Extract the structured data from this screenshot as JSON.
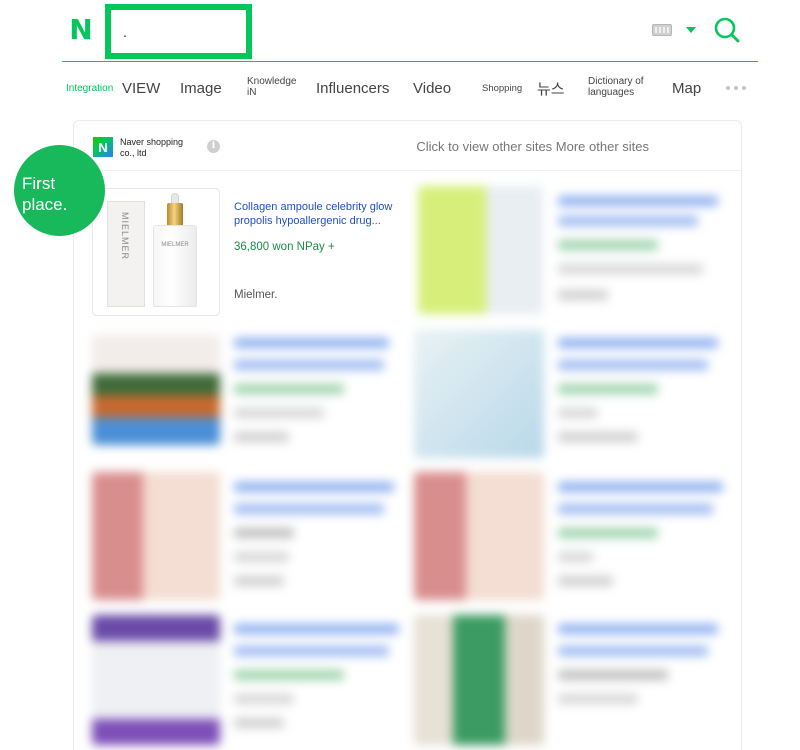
{
  "header": {
    "logo_letter": "N",
    "search_value": ".",
    "accent_color": "#03c75a"
  },
  "tabs": [
    {
      "label": "Integration",
      "active": true
    },
    {
      "label": "VIEW"
    },
    {
      "label": "Image"
    },
    {
      "label": "Knowledge iN"
    },
    {
      "label": "Influencers"
    },
    {
      "label": "Video"
    },
    {
      "label": "Shopping"
    },
    {
      "label": "뉴스"
    },
    {
      "label": "Dictionary of languages"
    },
    {
      "label": "Map"
    }
  ],
  "panel": {
    "seller_name": "Naver shopping co., ltd",
    "other_sites": "Click to view other sites More other sites"
  },
  "badge": {
    "label": "First place."
  },
  "featured_product": {
    "brand_on_box": "MIELMER",
    "title": "Collagen ampoule celebrity glow propolis hypoallergenic drug...",
    "price": "36,800 won NPay +",
    "store": "Mielmer."
  }
}
